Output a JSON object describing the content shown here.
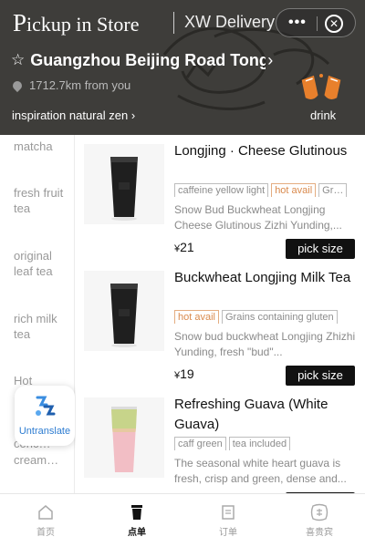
{
  "header": {
    "title_initial": "P",
    "title_rest": "ickup in Store",
    "delivery_label": "XW Delivery",
    "capsule_dots": "•••",
    "store_name": "Guangzhou Beijing Road Tong",
    "distance": "1712.7km from you",
    "inspiration": "inspiration natural zen",
    "drink_label": "drink"
  },
  "sidebar": {
    "categories": [
      "matcha",
      "fresh fruit tea",
      "original leaf tea",
      "rich milk tea",
      "Hot",
      "conc…",
      "cream…"
    ]
  },
  "untranslate_label": "Untranslate",
  "products": [
    {
      "name": "Longjing · Cheese Glutinous",
      "tags": [
        "caffeine yellow light",
        "hot avail",
        "Gr…"
      ],
      "description": "Snow Bud Buckwheat Longjing Cheese Glutinous Zizhi Yunding,...",
      "price": "21",
      "button": "pick size"
    },
    {
      "name": "Buckwheat Longjing Milk Tea",
      "tags": [
        "hot avail",
        "Grains containing gluten"
      ],
      "description": "Snow bud buckwheat Longjing Zhizhi Yunding, fresh \"bud\"...",
      "price": "19",
      "button": "pick size"
    },
    {
      "name": "Refreshing Guava (White Guava)",
      "tags": [
        "caff green",
        "tea included"
      ],
      "description": "The seasonal white heart guava is fresh, crisp and green, dense and...",
      "price": "",
      "button": ""
    }
  ],
  "currency_symbol": "¥",
  "bottom_nav": [
    {
      "label": "首页",
      "icon": "home-icon"
    },
    {
      "label": "点单",
      "icon": "cup-icon"
    },
    {
      "label": "订单",
      "icon": "order-icon"
    },
    {
      "label": "喜贵宾",
      "icon": "vip-icon"
    }
  ],
  "colors": {
    "header_bg": "#3e3d3a",
    "accent_orange": "#d98a4d",
    "button_bg": "#111111"
  }
}
